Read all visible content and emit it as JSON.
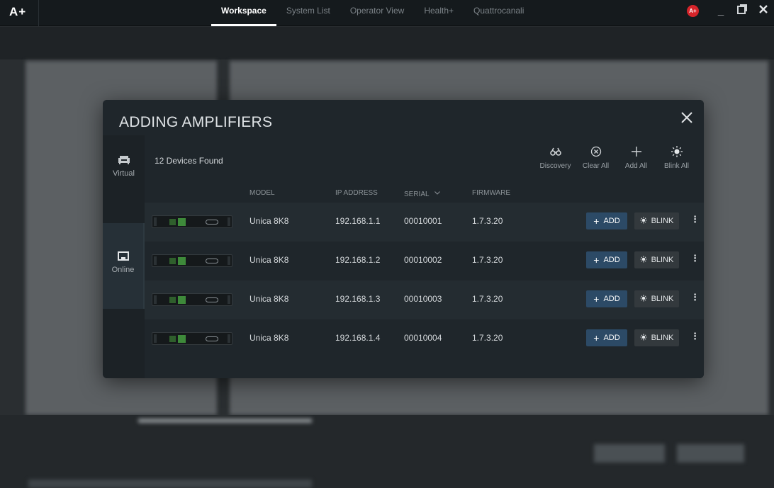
{
  "app": {
    "logo": "A+",
    "user_badge": "A+"
  },
  "nav": {
    "tabs": [
      {
        "label": "Workspace",
        "active": true
      },
      {
        "label": "System List",
        "active": false
      },
      {
        "label": "Operator View",
        "active": false
      },
      {
        "label": "Health+",
        "active": false
      },
      {
        "label": "Quattrocanali",
        "active": false
      }
    ]
  },
  "window_controls": {
    "minimize_icon": "minimize-icon",
    "restore_icon": "restore-icon",
    "close_icon": "close-icon"
  },
  "dialog": {
    "title": "ADDING AMPLIFIERS",
    "sidebar": [
      {
        "label": "Virtual",
        "icon": "sofa-icon",
        "active": false
      },
      {
        "label": "Online",
        "icon": "network-icon",
        "active": true
      }
    ],
    "devices_found": "12 Devices Found",
    "actions": [
      {
        "label": "Discovery",
        "icon": "binoculars-icon"
      },
      {
        "label": "Clear All",
        "icon": "circle-x-icon"
      },
      {
        "label": "Add All",
        "icon": "plus-icon"
      },
      {
        "label": "Blink All",
        "icon": "sun-icon"
      }
    ],
    "columns": {
      "model": "MODEL",
      "ip": "IP ADDRESS",
      "serial": "SERIAL",
      "firmware": "FIRMWARE"
    },
    "rows": [
      {
        "model": "Unica 8K8",
        "ip": "192.168.1.1",
        "serial": "00010001",
        "firmware": "1.7.3.20"
      },
      {
        "model": "Unica 8K8",
        "ip": "192.168.1.2",
        "serial": "00010002",
        "firmware": "1.7.3.20"
      },
      {
        "model": "Unica 8K8",
        "ip": "192.168.1.3",
        "serial": "00010003",
        "firmware": "1.7.3.20"
      },
      {
        "model": "Unica 8K8",
        "ip": "192.168.1.4",
        "serial": "00010004",
        "firmware": "1.7.3.20"
      }
    ],
    "row_add_label": "ADD",
    "row_blink_label": "BLINK",
    "row_menu_glyph": "⋮"
  },
  "colors": {
    "accent_blue": "#2c4a66",
    "badge_red": "#d6242a",
    "dialog_bg": "#1f262b"
  }
}
